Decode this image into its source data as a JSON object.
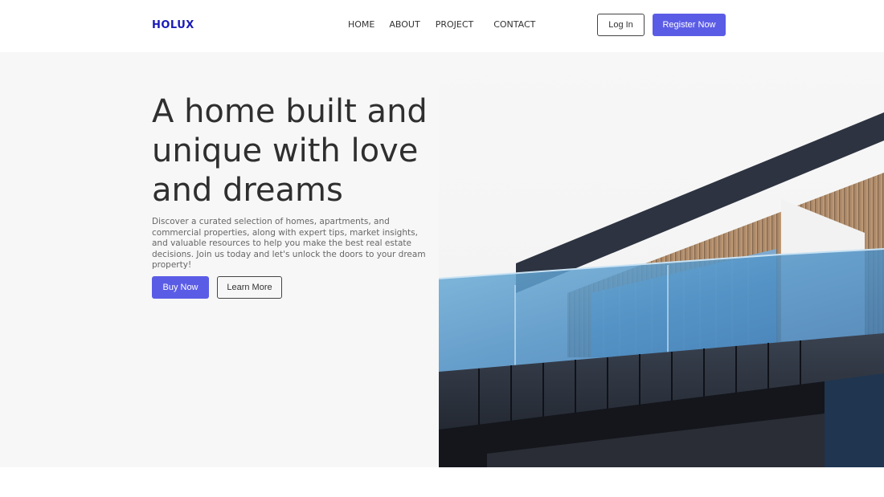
{
  "brand": {
    "name": "HOLUX",
    "color": "#1a1ab8"
  },
  "accent_color": "#5b5ce6",
  "nav": {
    "items": [
      {
        "label": "HOME"
      },
      {
        "label": "ABOUT"
      },
      {
        "label": "PROJECT"
      },
      {
        "label": "CONTACT"
      }
    ]
  },
  "header": {
    "login_label": "Log In",
    "register_label": "Register Now"
  },
  "hero": {
    "headline_lines": [
      "A home built and",
      "unique with love",
      "and dreams"
    ],
    "description": "Discover a curated selection of homes, apartments, and commercial properties, along with expert tips, market insights, and valuable resources to help you make the best real estate decisions. Join us today and let's unlock the doors to your dream property!",
    "buy_label": "Buy Now",
    "learn_label": "Learn More",
    "image_icon": "modern-house-balcony-photo"
  }
}
